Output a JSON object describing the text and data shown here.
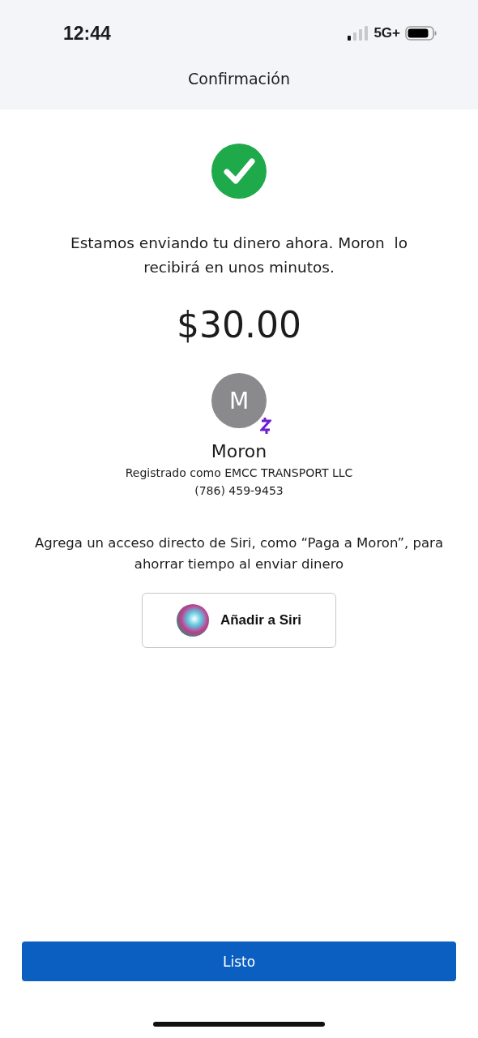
{
  "status_bar": {
    "time": "12:44",
    "network": "5G+"
  },
  "header": {
    "title": "Confirmación"
  },
  "message": "Estamos enviando tu dinero ahora. Moron  lo recibirá en unos minutos.",
  "amount": "$30.00",
  "recipient": {
    "initial": "M",
    "name": "Moron",
    "registered_as": "Registrado como EMCC TRANSPORT LLC",
    "phone": "(786) 459-9453"
  },
  "siri_hint": "Agrega un acceso directo de Siri, como “Paga a Moron”, para ahorrar tiempo al enviar dinero",
  "siri_button": {
    "label": "Añadir a Siri"
  },
  "done_button": {
    "label": "Listo"
  }
}
